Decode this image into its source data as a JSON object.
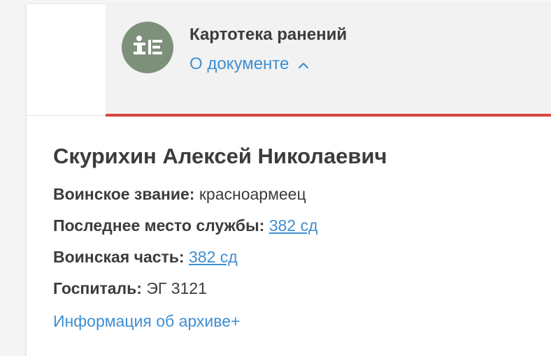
{
  "header": {
    "doc_type": "Картотека ранений",
    "about_toggle": "О документе",
    "icon": "wounded-card-icon",
    "chevron_icon": "chevron-up-icon"
  },
  "person": {
    "name": "Скурихин Алексей Николаевич",
    "fields": [
      {
        "label": "Воинское звание:",
        "value": "красноармеец",
        "link": false
      },
      {
        "label": "Последнее место службы:",
        "value": "382 сд",
        "link": true
      },
      {
        "label": "Воинская часть:",
        "value": "382 сд",
        "link": true
      },
      {
        "label": "Госпиталь:",
        "value": "ЭГ 3121",
        "link": false
      }
    ]
  },
  "archive_link": "Информация об архиве+",
  "colors": {
    "accent_red": "#d9463e",
    "link_blue": "#3f8fd2",
    "icon_green": "#7d917a",
    "text_dark": "#3c3c3c"
  }
}
